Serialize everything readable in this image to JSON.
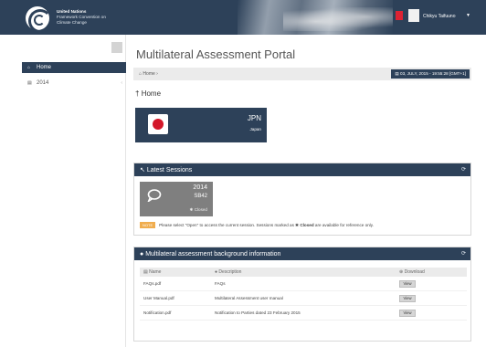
{
  "header": {
    "org_line1": "United Nations",
    "org_line2": "Framework Convention on",
    "org_line3": "Climate Change",
    "user_name": "Chikyu Taifuuno"
  },
  "sidebar": {
    "items": [
      {
        "label": "Home",
        "icon": "home-icon",
        "active": true
      },
      {
        "label": "2014",
        "icon": "folder-icon",
        "active": false
      }
    ]
  },
  "main": {
    "title": "Multilateral Assessment Portal",
    "breadcrumb": "Home",
    "datetime": "03, JULY, 2015 - 19:55:28 [GMT+1]",
    "section_heading": "Home",
    "country": {
      "code": "JPN",
      "name": "Japan"
    }
  },
  "sessions": {
    "title": "Latest Sessions",
    "tile": {
      "year": "2014",
      "code": "SB42",
      "status": "Closed"
    },
    "note_badge": "NOTE",
    "note_text_before": "Please select \"Open\" to access the current session. Sessions marked as",
    "note_bold": "Closed",
    "note_text_after": "are available for reference only."
  },
  "background": {
    "title": "Multilateral assessment background information",
    "columns": [
      "Name",
      "Description",
      "Download"
    ],
    "rows": [
      {
        "name": "FAQs.pdf",
        "description": "FAQs",
        "action": "View"
      },
      {
        "name": "User Manual.pdf",
        "description": "Multilateral Assessment user manual",
        "action": "View"
      },
      {
        "name": "Notification.pdf",
        "description": "Notification to Parties dated 23 February 2015",
        "action": "View"
      }
    ]
  },
  "colors": {
    "brand_navy": "#2d4159",
    "japan_red": "#d3172a",
    "note_orange": "#f0ad4e",
    "tile_gray": "#7f7f7f"
  }
}
